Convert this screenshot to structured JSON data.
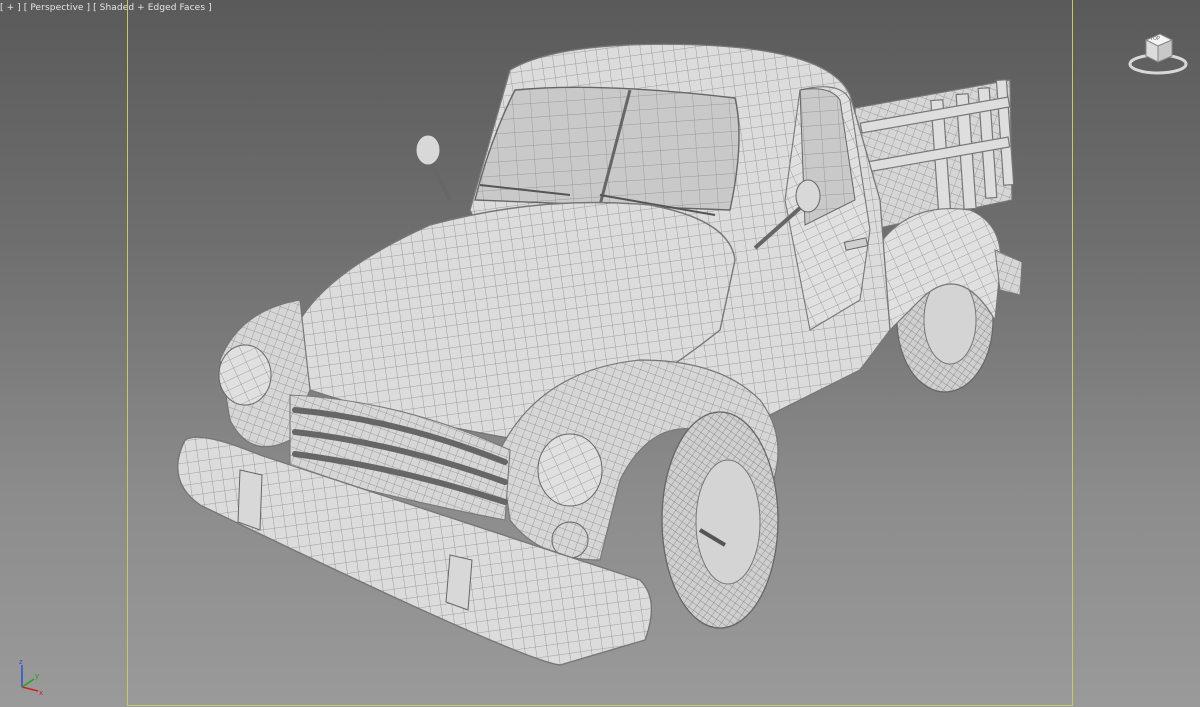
{
  "viewport": {
    "menu_label": "[ + ]",
    "view_label": "[ Perspective ]",
    "shading_label": "[ Shaded + Edged Faces ]"
  },
  "viewcube": {
    "face_label": "TOP"
  },
  "axes": {
    "x": "x",
    "y": "y",
    "z": "z"
  },
  "colors": {
    "frame_border": "#c8c86a",
    "axis_x": "#d02020",
    "axis_y": "#20a020",
    "axis_z": "#3050d0"
  },
  "icons": [
    "viewcube-icon",
    "axis-tripod-icon"
  ]
}
